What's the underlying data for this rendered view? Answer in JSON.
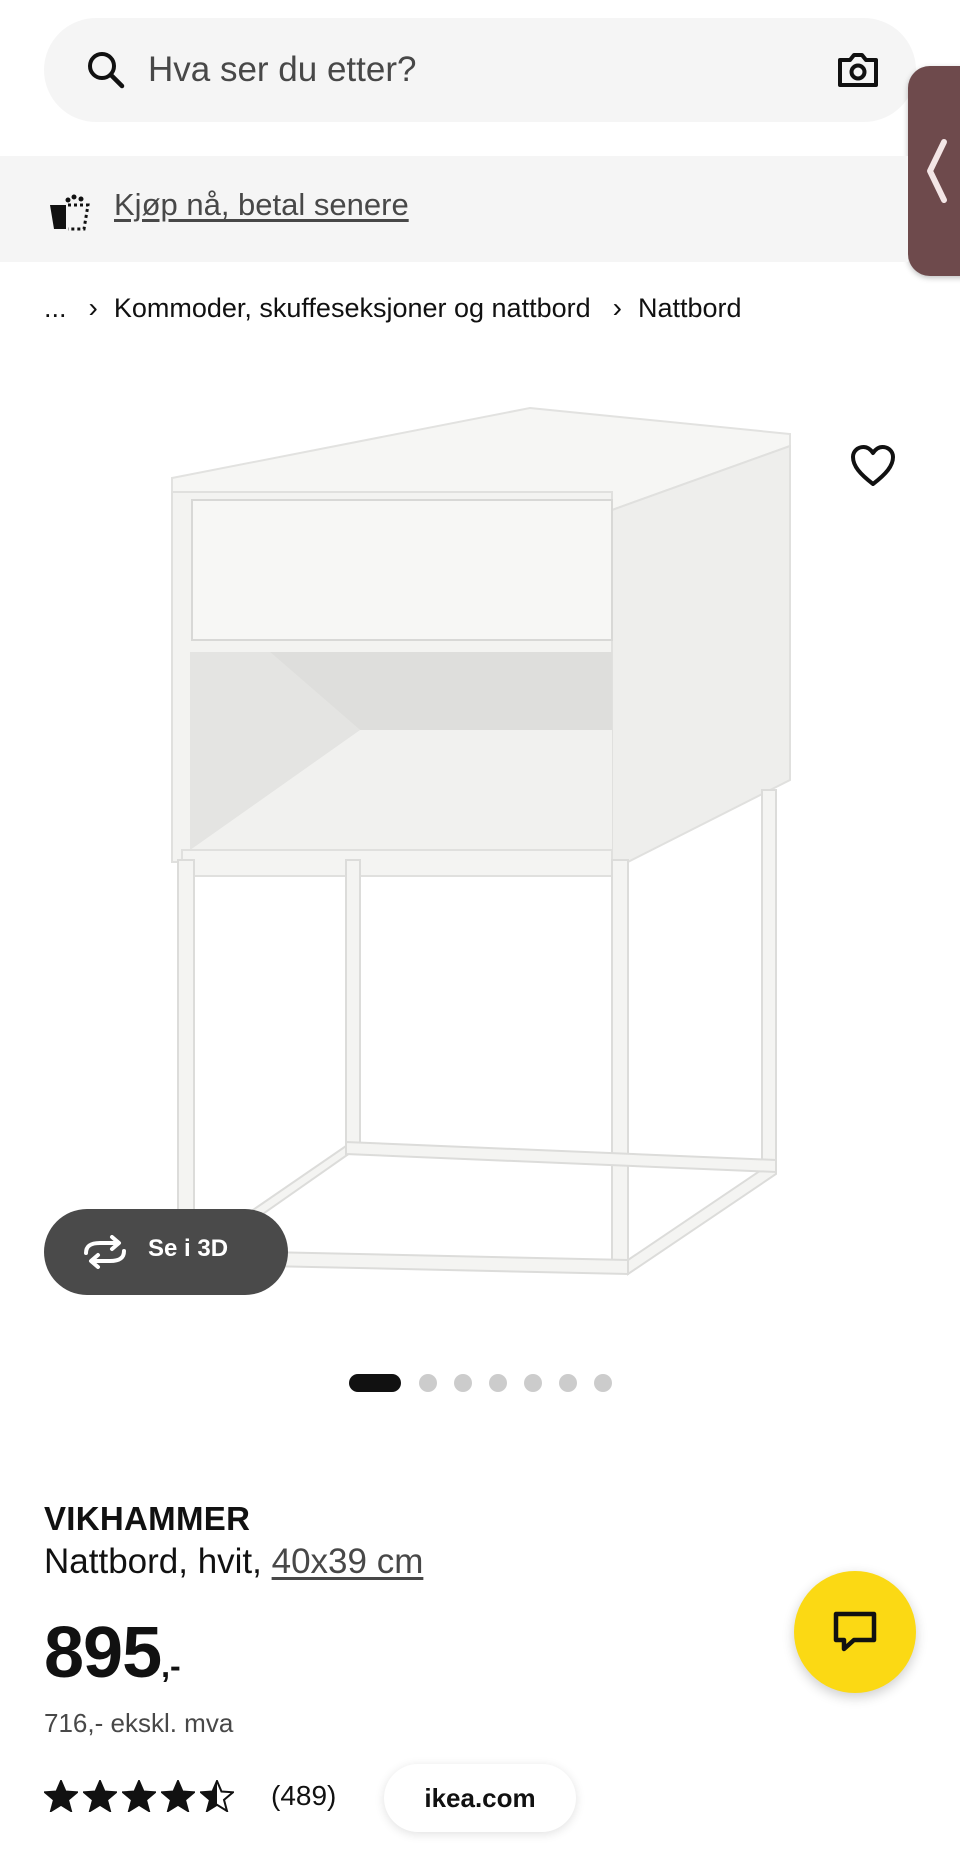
{
  "search": {
    "placeholder": "Hva ser du etter?"
  },
  "banner": {
    "link_text": "Kjøp nå, betal senere"
  },
  "breadcrumb": {
    "ellipsis": "...",
    "separator": "›",
    "items": [
      "Kommoder, skuffeseksjoner og nattbord",
      "Nattbord"
    ]
  },
  "gallery": {
    "view3d_label": "Se i 3D",
    "total_images": 7,
    "active_index": 0
  },
  "product": {
    "name": "VIKHAMMER",
    "description_prefix": "Nattbord, hvit, ",
    "size_link": "40x39 cm",
    "price_main": "895",
    "price_suffix": ",-",
    "price_ex_vat": "716,- ekskl. mva",
    "rating_value": 4.5,
    "rating_max": 5,
    "rating_count": "(489)"
  },
  "source_pill": "ikea.com",
  "colors": {
    "accent_yellow": "#fbd914",
    "side_tab": "#6e4a4c",
    "view3d_bg": "#4a4a4a",
    "text": "#111111",
    "muted_text": "#484848"
  },
  "icons": {
    "search": "search-icon",
    "camera": "camera-icon",
    "bnpl": "bnpl-icon",
    "favorite": "heart-icon",
    "view3d": "rotate-3d-icon",
    "chat": "chat-icon",
    "side_tab": "chevron-left-icon",
    "star": "star-icon"
  }
}
